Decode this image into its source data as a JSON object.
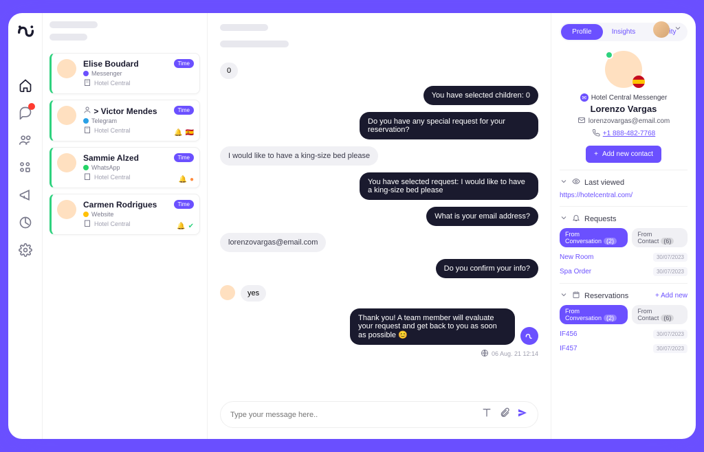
{
  "conversations": [
    {
      "name": "Elise Boudard",
      "channel": "Messenger",
      "hotel": "Hotel Central",
      "time": "Time"
    },
    {
      "name": "> Victor Mendes",
      "channel": "Telegram",
      "hotel": "Hotel Central",
      "time": "Time"
    },
    {
      "name": "Sammie Alzed",
      "channel": "WhatsApp",
      "hotel": "Hotel Central",
      "time": "Time"
    },
    {
      "name": "Carmen Rodrigues",
      "channel": "Website",
      "hotel": "Hotel Central",
      "time": "Time"
    }
  ],
  "messages": [
    {
      "side": "user",
      "text": "0"
    },
    {
      "side": "bot",
      "text": "You have selected children: 0"
    },
    {
      "side": "bot",
      "text": "Do you have any special request for your reservation?"
    },
    {
      "side": "user",
      "text": "I would like to have a king-size bed please"
    },
    {
      "side": "bot",
      "text": "You have selected request: I would like to have a king-size bed please"
    },
    {
      "side": "bot",
      "text": "What is your email address?"
    },
    {
      "side": "user",
      "text": "lorenzovargas@email.com"
    },
    {
      "side": "bot",
      "text": "Do you confirm your info?"
    },
    {
      "side": "user_av",
      "text": "yes"
    },
    {
      "side": "bot",
      "text": "Thank you! A team member will evaluate your request and get back to you as soon as possible 😊"
    }
  ],
  "timestamp": "06 Aug. 21 12:14",
  "input": {
    "placeholder": "Type your message here.."
  },
  "tabs": {
    "profile": "Profile",
    "insights": "Insights",
    "activity": "Activity"
  },
  "profile": {
    "source": "Hotel Central Messenger",
    "name": "Lorenzo Vargas",
    "email": "lorenzovargas@email.com",
    "phone": "+1 888-482-7768",
    "add": "Add new contact"
  },
  "lastviewed": {
    "label": "Last viewed",
    "url": "https://hotelcentral.com/"
  },
  "requests": {
    "label": "Requests",
    "from_conv": "From Conversation",
    "from_conv_n": "(2)",
    "from_contact": "From Contact",
    "from_contact_n": "(6)",
    "items": [
      {
        "name": "New Room",
        "date": "30/07/2023"
      },
      {
        "name": "Spa Order",
        "date": "30/07/2023"
      }
    ]
  },
  "reservations": {
    "label": "Reservations",
    "add": "+  Add new",
    "from_conv": "From Conversation",
    "from_conv_n": "(2)",
    "from_contact": "From Contact",
    "from_contact_n": "(6)",
    "items": [
      {
        "name": "IF456",
        "date": "30/07/2023"
      },
      {
        "name": "IF457",
        "date": "30/07/2023"
      }
    ]
  }
}
